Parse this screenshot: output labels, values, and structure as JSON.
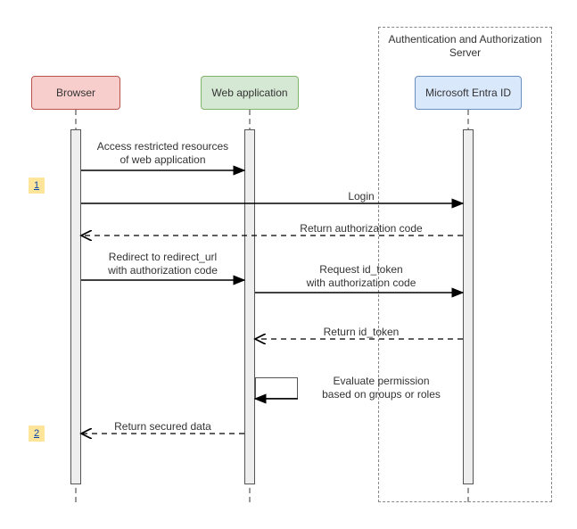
{
  "chart_data": {
    "type": "sequence",
    "container": {
      "title": "Authentication and\nAuthorization Server",
      "contains": [
        "Microsoft Entra ID"
      ]
    },
    "actors": [
      {
        "id": "browser",
        "label": "Browser",
        "fill": "#f8cecc",
        "stroke": "#b85450"
      },
      {
        "id": "webapp",
        "label": "Web application",
        "fill": "#d5e8d4",
        "stroke": "#82b366"
      },
      {
        "id": "entra",
        "label": "Microsoft Entra ID",
        "fill": "#dae8fc",
        "stroke": "#6c8ebf"
      }
    ],
    "steps": [
      {
        "badge": "1"
      },
      {
        "badge": "2"
      }
    ],
    "messages": [
      {
        "from": "browser",
        "to": "webapp",
        "style": "sync",
        "label": "Access restricted resources\nof web application"
      },
      {
        "from": "browser",
        "to": "entra",
        "style": "sync",
        "label": "Login"
      },
      {
        "from": "entra",
        "to": "browser",
        "style": "return",
        "label": "Return authorization code"
      },
      {
        "from": "browser",
        "to": "webapp",
        "style": "sync",
        "label": "Redirect to redirect_url\nwith authorization code"
      },
      {
        "from": "webapp",
        "to": "entra",
        "style": "sync",
        "label": "Request id_token\nwith authorization code"
      },
      {
        "from": "entra",
        "to": "webapp",
        "style": "return",
        "label": "Return id_token"
      },
      {
        "from": "webapp",
        "to": "webapp",
        "style": "self",
        "label": "Evaluate permission\nbased on groups or roles"
      },
      {
        "from": "webapp",
        "to": "browser",
        "style": "return",
        "label": "Return secured data"
      }
    ]
  }
}
